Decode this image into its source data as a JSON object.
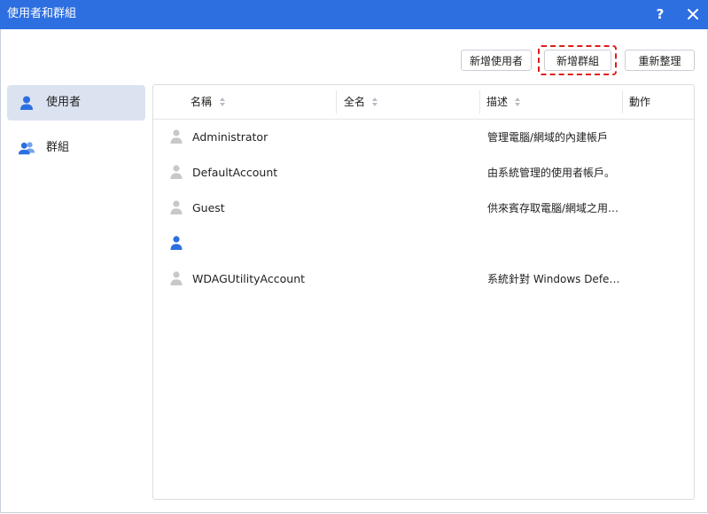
{
  "window": {
    "title": "使用者和群組",
    "help_label": "?"
  },
  "toolbar": {
    "add_user_label": "新增使用者",
    "add_group_label": "新增群組",
    "refresh_label": "重新整理"
  },
  "sidebar": {
    "items": [
      {
        "label": "使用者",
        "icon": "user-icon",
        "active": true
      },
      {
        "label": "群組",
        "icon": "group-icon",
        "active": false
      }
    ]
  },
  "table": {
    "columns": [
      "名稱",
      "全名",
      "描述",
      "動作"
    ],
    "rows": [
      {
        "name": "Administrator",
        "full_name": "",
        "description": "管理電腦/網域的內建帳戶",
        "icon_color": "#c8c8c8"
      },
      {
        "name": "DefaultAccount",
        "full_name": "",
        "description": "由系統管理的使用者帳戶。",
        "icon_color": "#c8c8c8"
      },
      {
        "name": "Guest",
        "full_name": "",
        "description": "供來賓存取電腦/網域之用的內建帳戶",
        "icon_color": "#c8c8c8"
      },
      {
        "name": "",
        "full_name": "",
        "description": "",
        "icon_color": "#2d6fe0"
      },
      {
        "name": "WDAGUtilityAccount",
        "full_name": "",
        "description": "系統針對 Windows Defender 應用程式防護案例管理和使用的使用者帳戶。",
        "icon_color": "#c8c8c8"
      }
    ]
  },
  "colors": {
    "accent": "#2d6fe0",
    "highlight": "#e01a1a",
    "sidebar_active": "#dbe3f1"
  }
}
